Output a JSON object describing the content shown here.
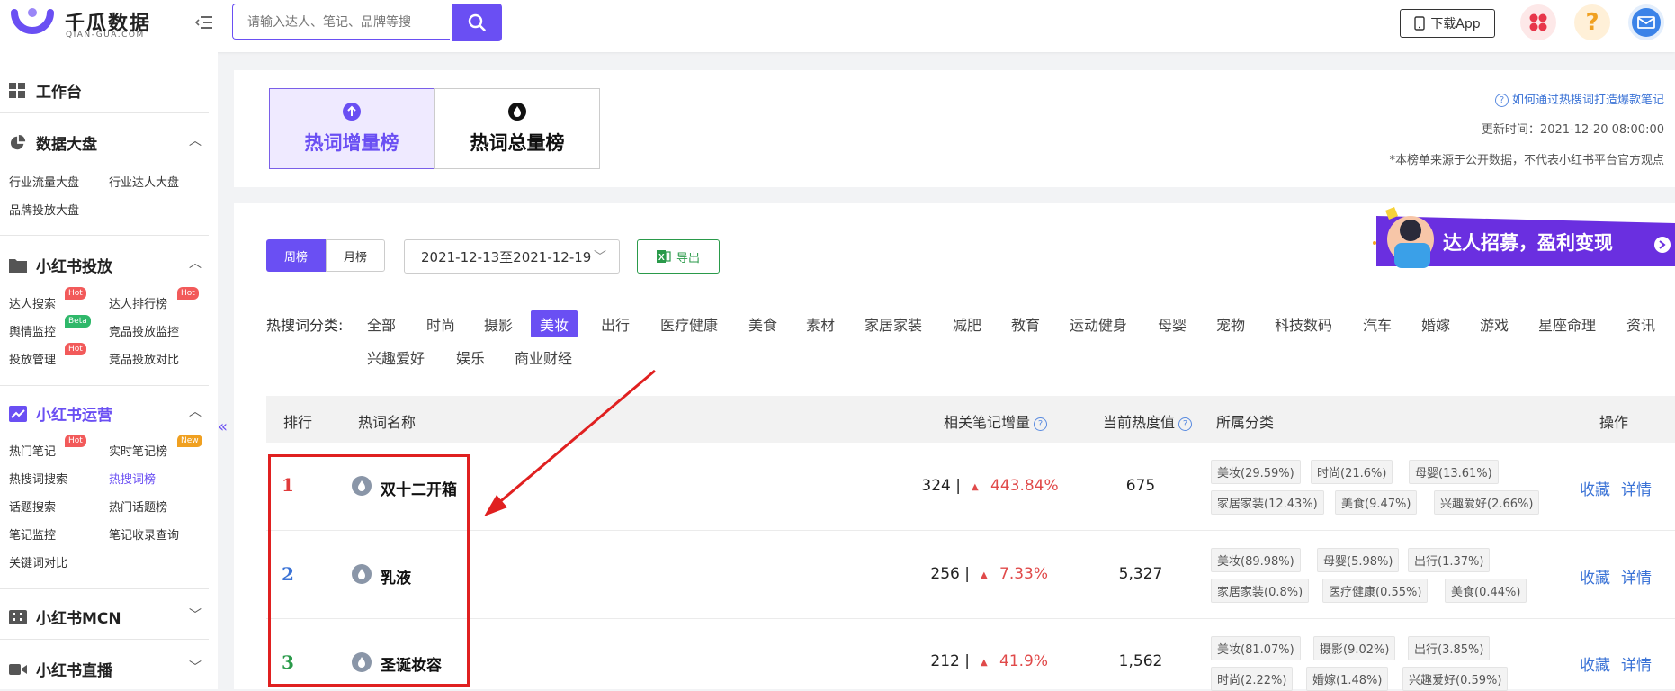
{
  "brand": {
    "name": "千瓜数据",
    "sub": "QIAN-GUA.COM"
  },
  "search": {
    "placeholder": "请输入达人、笔记、品牌等搜"
  },
  "topbar": {
    "download_label": "下载App",
    "help_glyph": "?"
  },
  "sidebar": {
    "workbench": "工作台",
    "sections": [
      {
        "title": "数据大盘",
        "items": [
          "行业流量大盘",
          "行业达人大盘",
          "品牌投放大盘"
        ]
      },
      {
        "title": "小红书投放",
        "items": [
          "达人搜索",
          "达人排行榜",
          "舆情监控",
          "竞品投放监控",
          "投放管理",
          "竞品投放对比"
        ]
      },
      {
        "title": "小红书运营",
        "items": [
          "热门笔记",
          "实时笔记榜",
          "热搜词搜索",
          "热搜词榜",
          "话题搜索",
          "热门话题榜",
          "笔记监控",
          "笔记收录查询",
          "关键词对比"
        ]
      },
      {
        "title": "小红书MCN",
        "items": []
      },
      {
        "title": "小红书直播",
        "items": []
      }
    ],
    "badges": {
      "hot": "Hot",
      "beta": "Beta",
      "new": "New"
    },
    "collapse_glyph": "«"
  },
  "header": {
    "tabs": [
      "热词增量榜",
      "热词总量榜"
    ],
    "guide_link": "如何通过热搜词打造爆款笔记",
    "update_time": "更新时间：2021-12-20 08:00:00",
    "disclaimer": "*本榜单来源于公开数据，不代表小红书平台官方观点"
  },
  "filters": {
    "period": [
      "周榜",
      "月榜"
    ],
    "date_range": "2021-12-13至2021-12-19",
    "export_label": "导出",
    "banner_text": "达人招募，盈利变现",
    "category_label": "热搜词分类:",
    "categories": [
      "全部",
      "时尚",
      "摄影",
      "美妆",
      "出行",
      "医疗健康",
      "美食",
      "素材",
      "家居家装",
      "减肥",
      "教育",
      "运动健身",
      "母婴",
      "宠物",
      "科技数码",
      "汽车",
      "婚嫁",
      "游戏",
      "星座命理",
      "资讯",
      "兴趣爱好",
      "娱乐",
      "商业财经"
    ],
    "active_category": "美妆"
  },
  "table": {
    "headers": {
      "rank": "排行",
      "name": "热词名称",
      "notes": "相关笔记增量",
      "heat": "当前热度值",
      "category": "所属分类",
      "ops": "操作"
    },
    "help_glyph": "?",
    "ops": {
      "fav": "收藏",
      "detail": "详情"
    },
    "rows": [
      {
        "rank": "1",
        "name": "双十二开箱",
        "notes": "324 |",
        "growth": "443.84%",
        "heat": "675",
        "tags": [
          "美妆(29.59%)",
          "时尚(21.6%)",
          "母婴(13.61%)",
          "家居家装(12.43%)",
          "美食(9.47%)",
          "兴趣爱好(2.66%)"
        ]
      },
      {
        "rank": "2",
        "name": "乳液",
        "notes": "256 |",
        "growth": "7.33%",
        "heat": "5,327",
        "tags": [
          "美妆(89.98%)",
          "母婴(5.98%)",
          "出行(1.37%)",
          "家居家装(0.8%)",
          "医疗健康(0.55%)",
          "美食(0.44%)"
        ]
      },
      {
        "rank": "3",
        "name": "圣诞妆容",
        "notes": "212 |",
        "growth": "41.9%",
        "heat": "1,562",
        "tags": [
          "美妆(81.07%)",
          "摄影(9.02%)",
          "出行(3.85%)",
          "时尚(2.22%)",
          "婚嫁(1.48%)",
          "兴趣爱好(0.59%)"
        ]
      }
    ]
  },
  "colors": {
    "accent": "#6a4ff3",
    "rank1": "#e03a3a",
    "rank2": "#3b73d6",
    "rank3": "#2a9a4a",
    "growth": "#e04a4a",
    "annotation": "#e02020"
  }
}
